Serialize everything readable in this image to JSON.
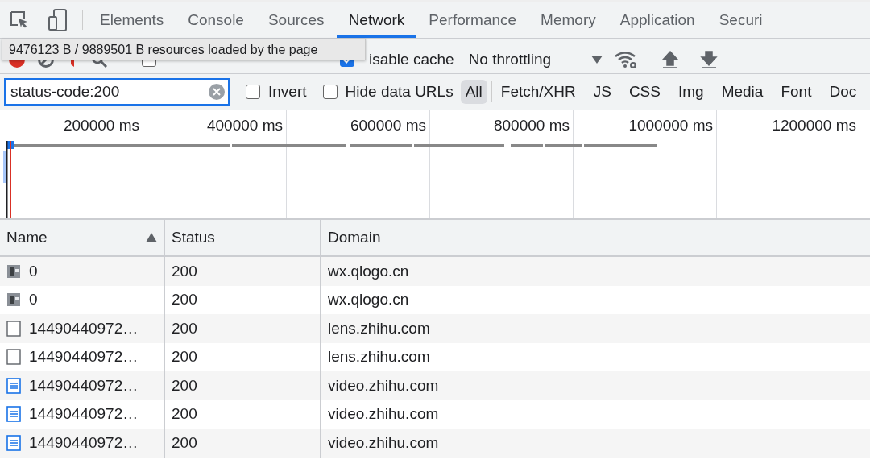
{
  "tabs": [
    {
      "label": "Elements",
      "selected": false
    },
    {
      "label": "Console",
      "selected": false
    },
    {
      "label": "Sources",
      "selected": false
    },
    {
      "label": "Network",
      "selected": true
    },
    {
      "label": "Performance",
      "selected": false
    },
    {
      "label": "Memory",
      "selected": false
    },
    {
      "label": "Application",
      "selected": false
    },
    {
      "label": "Securi",
      "selected": false
    }
  ],
  "tooltip": "9476123 B / 9889501 B resources loaded by the page",
  "toolbar": {
    "preserve_log": {
      "checked": false
    },
    "disable_cache": {
      "label": "isable cache",
      "checked": true
    },
    "throttling": "No throttling"
  },
  "filter": {
    "value": "status-code:200",
    "invert": {
      "label": "Invert",
      "checked": false
    },
    "hide_data_urls": {
      "label": "Hide data URLs",
      "checked": false
    },
    "types": [
      {
        "label": "All",
        "selected": true
      },
      {
        "label": "Fetch/XHR",
        "selected": false
      },
      {
        "label": "JS",
        "selected": false
      },
      {
        "label": "CSS",
        "selected": false
      },
      {
        "label": "Img",
        "selected": false
      },
      {
        "label": "Media",
        "selected": false
      },
      {
        "label": "Font",
        "selected": false
      },
      {
        "label": "Doc",
        "selected": false
      }
    ]
  },
  "overview": {
    "ticks": [
      "200000 ms",
      "400000 ms",
      "600000 ms",
      "800000 ms",
      "1000000 ms",
      "1200000 ms"
    ]
  },
  "table": {
    "columns": [
      {
        "label": "Name",
        "sorted": true
      },
      {
        "label": "Status",
        "sorted": false
      },
      {
        "label": "Domain",
        "sorted": false
      }
    ],
    "rows": [
      {
        "kind": "image",
        "name": "0",
        "status": "200",
        "domain": "wx.qlogo.cn"
      },
      {
        "kind": "image",
        "name": "0",
        "status": "200",
        "domain": "wx.qlogo.cn"
      },
      {
        "kind": "blank",
        "name": "14490440972…",
        "status": "200",
        "domain": "lens.zhihu.com"
      },
      {
        "kind": "blank",
        "name": "14490440972…",
        "status": "200",
        "domain": "lens.zhihu.com"
      },
      {
        "kind": "document",
        "name": "14490440972…",
        "status": "200",
        "domain": "video.zhihu.com"
      },
      {
        "kind": "document",
        "name": "14490440972…",
        "status": "200",
        "domain": "video.zhihu.com"
      },
      {
        "kind": "document",
        "name": "14490440972…",
        "status": "200",
        "domain": "video.zhihu.com"
      }
    ]
  }
}
